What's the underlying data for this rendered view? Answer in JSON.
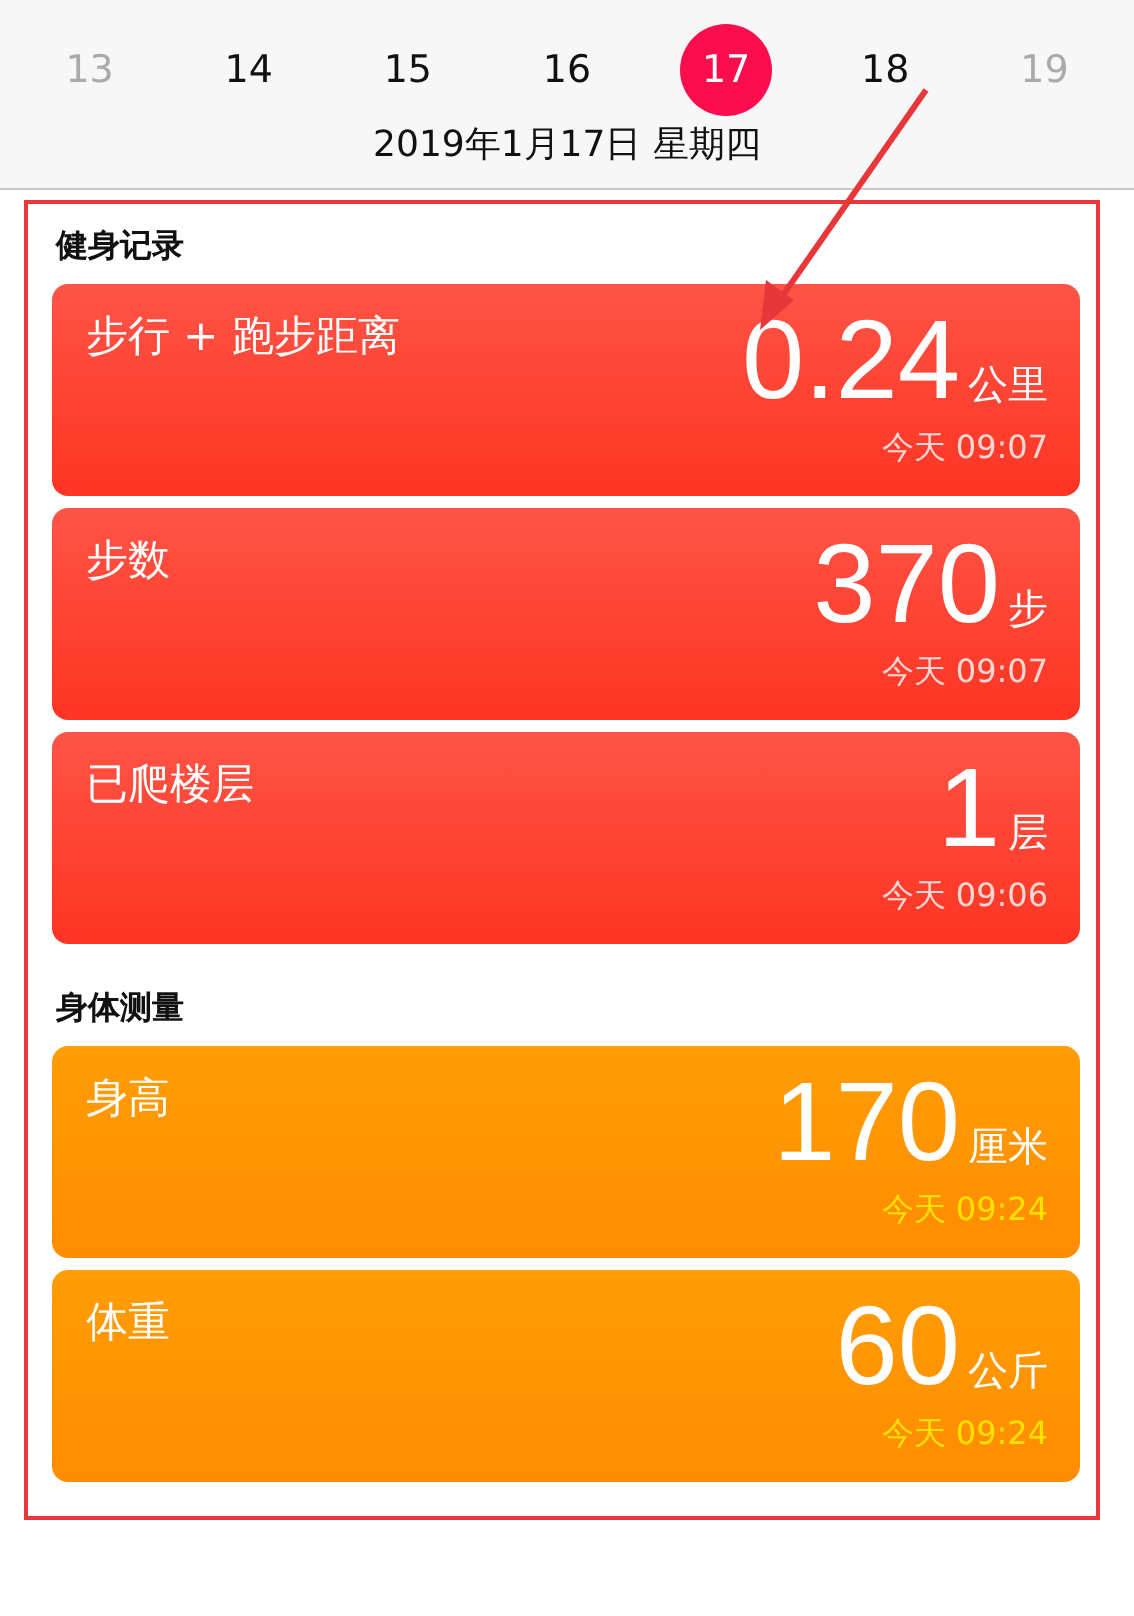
{
  "days": [
    {
      "label": "13",
      "selected": false,
      "dimmed": true
    },
    {
      "label": "14",
      "selected": false,
      "dimmed": false
    },
    {
      "label": "15",
      "selected": false,
      "dimmed": false
    },
    {
      "label": "16",
      "selected": false,
      "dimmed": false
    },
    {
      "label": "17",
      "selected": true,
      "dimmed": false
    },
    {
      "label": "18",
      "selected": false,
      "dimmed": false
    },
    {
      "label": "19",
      "selected": false,
      "dimmed": true
    }
  ],
  "date": "2019年1月17日 星期四",
  "sections": [
    {
      "title": "健身记录",
      "kind": "activity",
      "cards": [
        {
          "title": "步行 + 跑步距离",
          "value": "0.24",
          "unit": "公里",
          "time": "今天 09:07"
        },
        {
          "title": "步数",
          "value": "370",
          "unit": "步",
          "time": "今天 09:07"
        },
        {
          "title": "已爬楼层",
          "value": "1",
          "unit": "层",
          "time": "今天 09:06"
        }
      ]
    },
    {
      "title": "身体测量",
      "kind": "body",
      "cards": [
        {
          "title": "身高",
          "value": "170",
          "unit": "厘米",
          "time": "今天 09:24"
        },
        {
          "title": "体重",
          "value": "60",
          "unit": "公斤",
          "time": "今天 09:24"
        }
      ]
    }
  ]
}
